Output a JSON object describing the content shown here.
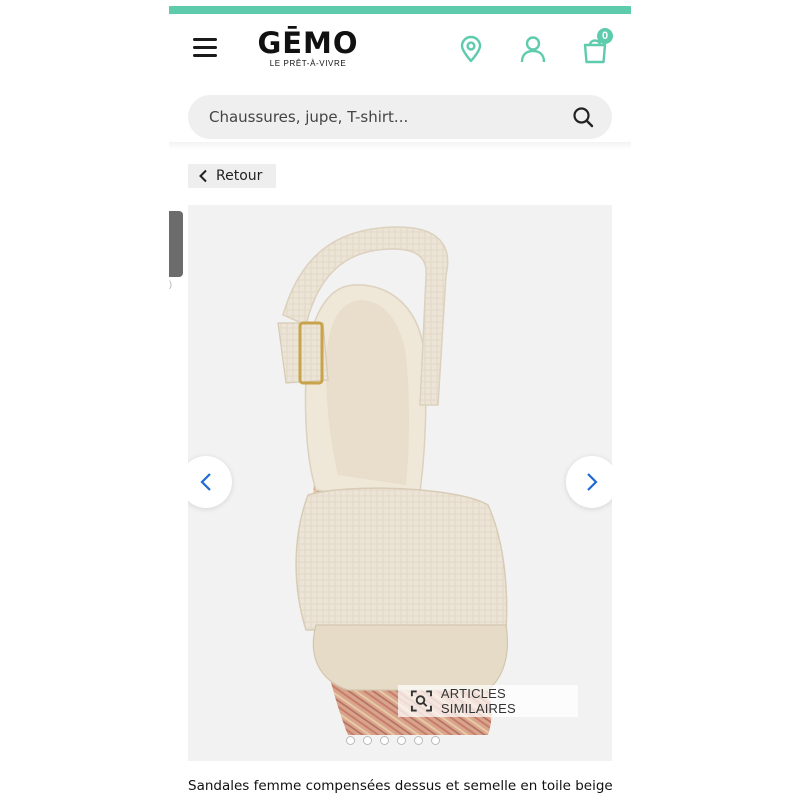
{
  "header": {
    "brand": "GĒMO",
    "tagline": "LE PRÊT-À-VIVRE",
    "cart_count": "0",
    "accent_color": "#5fcbad"
  },
  "search": {
    "placeholder": "Chaussures, jupe, T-shirt..."
  },
  "back": {
    "label": "Retour"
  },
  "gallery": {
    "similar_label": "ARTICLES SIMILAIRES",
    "slide_count": 6,
    "active_slide": 0
  },
  "product": {
    "title": "Sandales femme compensées dessus et semelle en toile beige"
  },
  "icons": [
    "menu-icon",
    "store-locator-icon",
    "account-icon",
    "cart-icon",
    "search-icon",
    "chevron-left-icon",
    "chevron-right-icon",
    "visual-search-icon"
  ]
}
